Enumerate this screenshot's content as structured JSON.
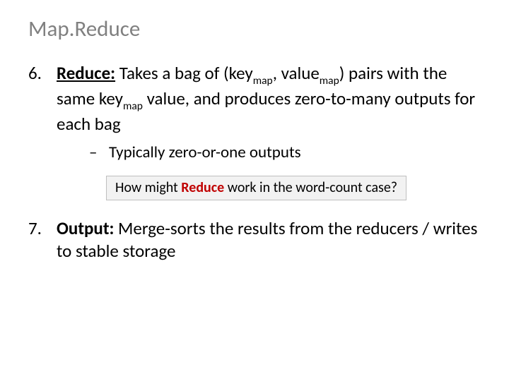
{
  "title": "Map.Reduce",
  "items": [
    {
      "num": "6.",
      "label": "Reduce:",
      "body_a": " Takes a bag of (",
      "key1": "key",
      "key1_sub": "map",
      "sep": ", ",
      "val1": "value",
      "val1_sub": "map",
      "body_b": ") pairs with the same ",
      "key2": "key",
      "key2_sub": "map",
      "body_c": " value, and produces zero-to-many outputs for each bag",
      "sub": "Typically zero-or-one outputs"
    },
    {
      "num": "7.",
      "label": "Output:",
      "body": " Merge-sorts the results from the reducers / writes to stable storage"
    }
  ],
  "callout": {
    "pre": "How might ",
    "word": "Reduce",
    "post": " work in the word-count case?"
  }
}
